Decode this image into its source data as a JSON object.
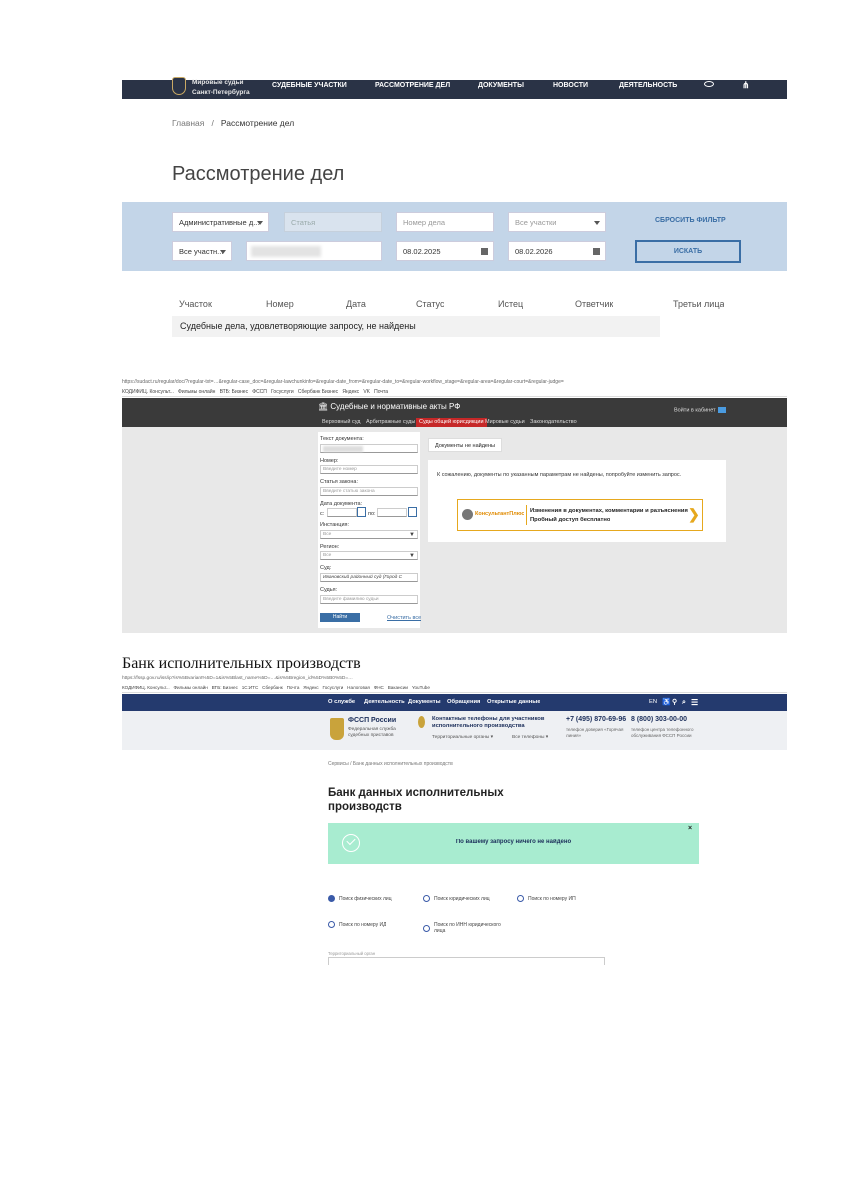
{
  "s1": {
    "brand_line1": "Мировые судьи",
    "brand_line2": "Санкт-Петербурга",
    "nav": [
      "СУДЕБНЫЕ УЧАСТКИ",
      "РАССМОТРЕНИЕ ДЕЛ",
      "ДОКУМЕНТЫ",
      "НОВОСТИ",
      "ДЕЯТЕЛЬНОСТЬ"
    ],
    "breadcrumb": {
      "home": "Главная",
      "sep": "/",
      "current": "Рассмотрение дел"
    },
    "title": "Рассмотрение дел",
    "filter": {
      "category": "Административные д...",
      "article_placeholder": "Статья",
      "case_number_placeholder": "Номер дела",
      "sections": "Все участки",
      "parties": "Все участн...",
      "date_from": "08.02.2025",
      "date_to": "08.02.2026",
      "reset": "СБРОСИТЬ ФИЛЬТР",
      "search": "ИСКАТЬ"
    },
    "columns": [
      "Участок",
      "Номер",
      "Дата",
      "Статус",
      "Истец",
      "Ответчик",
      "Третьи лица"
    ],
    "empty_message": "Судебные дела, удовлетворяющие запросу, не найдены"
  },
  "s2": {
    "url": "https://sudact.ru/regular/doc/?regular-txt=…&regular-case_doc=&regular-lawchunkinfo=&regular-date_from=&regular-date_to=&regular-workflow_stage=&regular-area=&regular-court=&regular-judge=",
    "bookmarks": [
      "КОДИФИЦ. Консульт...",
      "Фильмы онлайн",
      "ВТБ: Бизнес",
      "ФССП",
      "Госуслуги",
      "Сбербанк Бизнес",
      "Яндекс",
      "VK",
      "Почта"
    ],
    "brand": "Судебные и нормативные акты РФ",
    "login": "Войти в кабинет",
    "tabs": [
      "Верховный суд",
      "Арбитражные суды",
      "Суды общей юрисдикции",
      "Мировые судьи",
      "Законодательство"
    ],
    "form": {
      "doc_text_label": "Текст документа:",
      "number_label": "Номер:",
      "number_placeholder": "Введите номер",
      "law_label": "Статья закона:",
      "law_placeholder": "Введите статью закона",
      "date_label": "Дата документа:",
      "date_from_label": "с:",
      "date_to_label": "по:",
      "instance_label": "Инстанция:",
      "instance_value": "Все",
      "region_label": "Регион:",
      "region_value": "Все",
      "court_label": "Суд:",
      "court_value": "Ивановский районный суд (Город С",
      "judge_label": "Судья:",
      "judge_placeholder": "Введите фамилию судьи",
      "find": "Найти",
      "clear": "Очистить все"
    },
    "not_found_tab": "Документы не найдены",
    "message": "К сожалению, документы по указанным параметрам не найдены, попробуйте изменить запрос.",
    "banner": {
      "brand": "КонсультантПлюс",
      "line1": "Изменения в документах, комментарии и разъяснения",
      "line2": "Пробный доступ бесплатно"
    }
  },
  "s3": {
    "caption": "Банк исполнительных производств",
    "url": "https://fssp.gov.ru/iss/ip?is%5Bvariant%5D=1&is%5Blast_name%5D=…&is%5Bregion_id%5D%5B0%5D=…",
    "bookmarks": [
      "КОДИФИЦ. Консульт...",
      "Фильмы онлайн",
      "ВТБ: Бизнес",
      "1С:ИТС",
      "Сбербанк",
      "Почта",
      "Яндекс",
      "Госуслуги",
      "Налоговая",
      "ФНС",
      "Вакансии",
      "YouTube"
    ],
    "nav": [
      "О службе",
      "Деятельность",
      "Документы",
      "Обращения",
      "Открытые данные"
    ],
    "lang": "EN",
    "org": "ФССП России",
    "org_sub": "Федеральная служба судебных приставов",
    "contact": "Контактные телефоны для участников исполнительного производства",
    "territorial": "Территориальные органы",
    "all_phones": "Все телефоны",
    "phone1": "+7 (495) 870-69-96",
    "phone1_sub": "телефон доверия «Горячая линия»",
    "phone2": "8 (800) 303-00-00",
    "phone2_sub": "телефон центра телефонного обслуживания ФССП России",
    "breadcrumb": "Сервисы / Банк данных исполнительных производств",
    "title": "Банк данных исполнительных производств",
    "alert": "По вашему запросу ничего не найдено",
    "options": [
      {
        "label": "Поиск физических лиц",
        "selected": true
      },
      {
        "label": "Поиск юридических лиц",
        "selected": false
      },
      {
        "label": "Поиск по номеру ИП",
        "selected": false
      },
      {
        "label": "Поиск по номеру ИД",
        "selected": false
      },
      {
        "label": "Поиск по ИНН юридического лица",
        "selected": false
      }
    ],
    "territorial_label": "Территориальный орган"
  },
  "colors": {
    "nav_dark": "#2a3346",
    "filter_bg": "#c3d5e8",
    "link_blue": "#3a6ea5",
    "fssp_blue": "#243a6e",
    "alert_green": "#a8ecd0",
    "accent_red": "#c62828",
    "banner_orange": "#e6a81e"
  }
}
